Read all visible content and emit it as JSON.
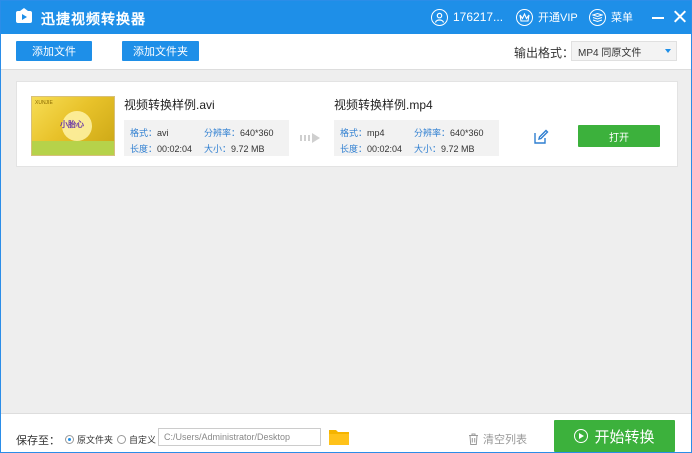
{
  "app": {
    "title": "迅捷视频转换器",
    "user": "176217...",
    "vip_label": "开通VIP",
    "menu_label": "菜单"
  },
  "toolbar": {
    "add_file": "添加文件",
    "add_folder": "添加文件夹",
    "format_label": "输出格式：",
    "format_value": "MP4  同原文件"
  },
  "file": {
    "thumb_tag": "小胎心",
    "thumb_logo": "XUNJIE",
    "source": {
      "name": "视频转换样例.avi",
      "format_key": "格式：",
      "format": "avi",
      "resolution_key": "分辨率：",
      "resolution": "640*360",
      "duration_key": "长度：",
      "duration": "00:02:04",
      "size_key": "大小：",
      "size": "9.72 MB"
    },
    "target": {
      "name": "视频转换样例.mp4",
      "format_key": "格式：",
      "format": "mp4",
      "resolution_key": "分辨率：",
      "resolution": "640*360",
      "duration_key": "长度：",
      "duration": "00:02:04",
      "size_key": "大小：",
      "size": "9.72 MB"
    },
    "open_label": "打开"
  },
  "bottom": {
    "save_to": "保存至：",
    "original_folder": "原文件夹",
    "custom": "自定义",
    "path": "C:/Users/Administrator/Desktop",
    "clear_list": "清空列表",
    "start": "开始转换"
  },
  "colors": {
    "brand_blue": "#1e8fe8",
    "action_green": "#3cb13c",
    "folder_yellow": "#f5b400"
  }
}
